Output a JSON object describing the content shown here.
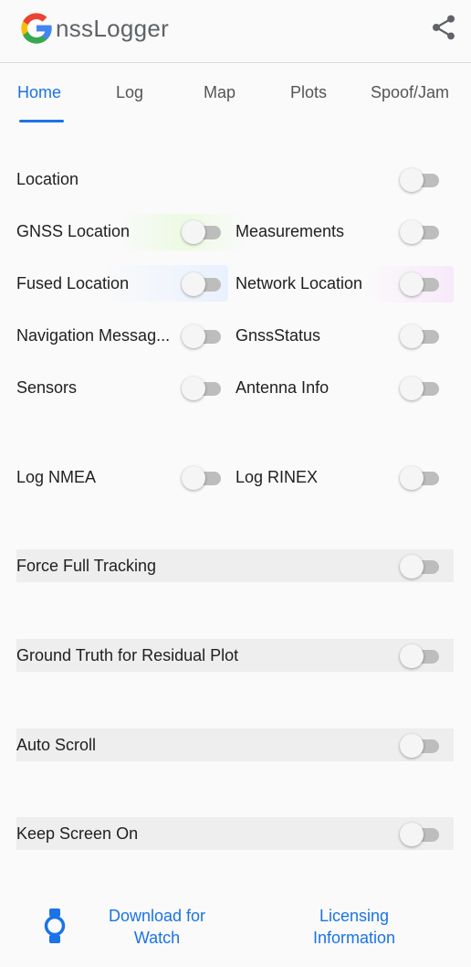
{
  "app": {
    "title": "nssLogger",
    "logo_icon": "google-g-icon",
    "share_icon": "share-icon",
    "colors": {
      "accent": "#1a73e8",
      "red": "#ea4335",
      "yellow": "#fbbc05",
      "green": "#34a853",
      "blue": "#4285f4"
    }
  },
  "tabs": [
    {
      "label": "Home",
      "active": true
    },
    {
      "label": "Log",
      "active": false
    },
    {
      "label": "Map",
      "active": false
    },
    {
      "label": "Plots",
      "active": false
    },
    {
      "label": "Spoof/Jam",
      "active": false
    }
  ],
  "settings": {
    "location": {
      "label": "Location",
      "on": false
    },
    "gnss_location": {
      "label": "GNSS Location",
      "on": false
    },
    "measurements": {
      "label": "Measurements",
      "on": false
    },
    "fused_location": {
      "label": "Fused Location",
      "on": false
    },
    "network_location": {
      "label": "Network Location",
      "on": false
    },
    "navigation_messages": {
      "label": "Navigation Messag...",
      "on": false
    },
    "gnss_status": {
      "label": "GnssStatus",
      "on": false
    },
    "sensors": {
      "label": "Sensors",
      "on": false
    },
    "antenna_info": {
      "label": "Antenna Info",
      "on": false
    },
    "log_nmea": {
      "label": "Log NMEA",
      "on": false
    },
    "log_rinex": {
      "label": "Log RINEX",
      "on": false
    },
    "force_full_tracking": {
      "label": "Force Full Tracking",
      "on": false
    },
    "ground_truth": {
      "label": "Ground Truth for Residual Plot",
      "on": false
    },
    "auto_scroll": {
      "label": "Auto Scroll",
      "on": false
    },
    "keep_screen_on": {
      "label": "Keep Screen On",
      "on": false
    }
  },
  "footer": {
    "watch_icon": "watch-icon",
    "download_line1": "Download for",
    "download_line2": "Watch",
    "licensing_line1": "Licensing",
    "licensing_line2": "Information"
  }
}
